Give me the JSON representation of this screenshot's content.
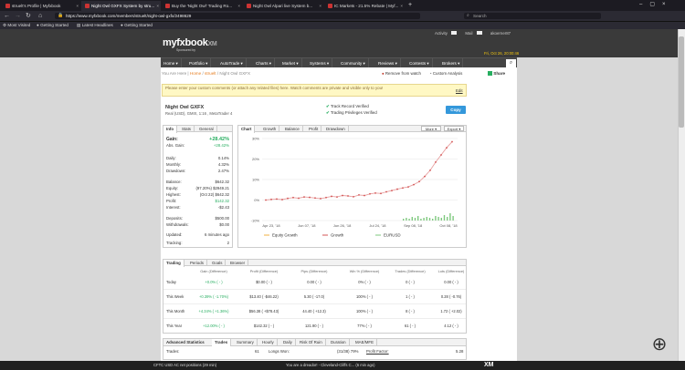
{
  "tabs": [
    {
      "label": "struelt's Profile | Myfxbook",
      "active": false
    },
    {
      "label": "Night Owl GXFX System by stru...",
      "active": true
    },
    {
      "label": "Buy the 'Night Owl' Trading Ro...",
      "active": false
    },
    {
      "label": "Night Owl Alpari live System b...",
      "active": false
    },
    {
      "label": "IC Markets - 21.5% Rebate | Myf...",
      "active": false
    }
  ],
  "browser": {
    "url": "https://www.myfxbook.com/members/struelt/night-owl-gxfx/2498629",
    "search_placeholder": "Search",
    "bookmarks": [
      "Most Visited",
      "Getting Started",
      "Latest Headlines",
      "Getting Started"
    ]
  },
  "site": {
    "logo": "myfxbook",
    "logo_sponsor": "Sponsored by",
    "logo_xm": "XM",
    "activity_label": "Activity",
    "mail_label": "Mail",
    "username": "akoerner87",
    "date": "Fri, Oct 26, 20:00:46",
    "nav": [
      "Home ▾",
      "Portfolio ▾",
      "AutoTrade ▾",
      "Charts ▾",
      "Market ▾",
      "Systems ▾",
      "Community ▾",
      "Reviews ▾",
      "Contests ▾",
      "Brokers ▾"
    ]
  },
  "breadcrumb": {
    "prefix": "You Are Here |",
    "home": "Home",
    "user": "struelt",
    "page": "Night Owl GXFX",
    "remove_watch": "Remove from watch",
    "custom_analysis": "Custom Analysis",
    "share": "Share"
  },
  "notice": {
    "text": "Please enter your custom comments (or attach any related files) here. Watch comments are private and visible only to you!",
    "edit": "Edit"
  },
  "system": {
    "name": "Night Owl GXFX",
    "details": "Real (USD), GMIX, 1:16 , MetaTrader 4",
    "track_verified": "Track Record Verified",
    "privileges_verified": "Trading Privileges Verified",
    "copy": "Copy"
  },
  "info": {
    "tabs": [
      "Info",
      "Stats",
      "General"
    ],
    "rows": [
      {
        "label": "Gain:",
        "value": "+28.42%",
        "cls": "green",
        "bold": true
      },
      {
        "label": "Abs. Gain:",
        "value": "+28.42%",
        "cls": "green"
      },
      {
        "label": "Daily:",
        "value": "0.14%",
        "cls": ""
      },
      {
        "label": "Monthly:",
        "value": "4.32%",
        "cls": ""
      },
      {
        "label": "Drawdown:",
        "value": "2.47%",
        "cls": ""
      },
      {
        "label": "Balance:",
        "value": "$642.32",
        "cls": ""
      },
      {
        "label": "Equity:",
        "value": "(97.20%) $2949.21",
        "cls": ""
      },
      {
        "label": "Highest:",
        "value": "(Oct 22) $642.32",
        "cls": ""
      },
      {
        "label": "Profit:",
        "value": "$142.32",
        "cls": "green"
      },
      {
        "label": "Interest:",
        "value": "-$2.43",
        "cls": ""
      },
      {
        "label": "Deposits:",
        "value": "$500.00",
        "cls": ""
      },
      {
        "label": "Withdrawals:",
        "value": "$0.00",
        "cls": ""
      },
      {
        "label": "Updated:",
        "value": "6 minutes ago",
        "cls": ""
      },
      {
        "label": "Tracking:",
        "value": "2",
        "cls": ""
      }
    ]
  },
  "chart_panel": {
    "tabs": [
      "Chart",
      "Growth",
      "Balance",
      "Profit",
      "Drawdown"
    ],
    "more": "More ▾",
    "export": "Export ▾",
    "legend": [
      "Equity Growth",
      "Growth",
      "EURUSD"
    ]
  },
  "chart_data": {
    "type": "line",
    "ylim": [
      -10,
      30
    ],
    "yticks": [
      "30%",
      "20%",
      "10%",
      "0%",
      "-10%"
    ],
    "xticks": [
      "Apr 23, '18",
      "Jun 07, '18",
      "Jun 26, '18",
      "Jul 24, '18",
      "Sep 08, '18",
      "Oct 08, '18"
    ],
    "series": [
      {
        "name": "Growth",
        "values": [
          0,
          0.3,
          0.5,
          0.2,
          0.8,
          1.2,
          0.9,
          1.5,
          1.3,
          1.0,
          0.7,
          1.2,
          1.8,
          1.5,
          2.2,
          2.0,
          1.6,
          2.5,
          2.2,
          3.0,
          3.4,
          3.2,
          4.0,
          4.6,
          5.3,
          5.9,
          6.4,
          7.5,
          9.0,
          11.5,
          14.5,
          18.5,
          22.0,
          25.5,
          28.42
        ]
      }
    ]
  },
  "trading": {
    "tabs": [
      "Trading",
      "Periods",
      "Goals",
      "Browser"
    ],
    "headers": [
      "Gain (Difference)",
      "Profit (Difference)",
      "Pips (Difference)",
      "Win % (Difference)",
      "Trades (Difference)",
      "Lots (Difference)"
    ],
    "rows": [
      {
        "label": "Today",
        "cells": [
          "+0.0% ( - )",
          "$0.00 ( - )",
          "0.00 ( - )",
          "0% ( - )",
          "0 ( - )",
          "0.00 ( - )"
        ]
      },
      {
        "label": "This Week",
        "cells": [
          "+0.39% ( -1.70%)",
          "$13.40 ( -$46.22)",
          "5.30 ( -17.0)",
          "100% ( - )",
          "1 ( - )",
          "0.28 ( -0.76)"
        ]
      },
      {
        "label": "This Month",
        "cells": [
          "+4.34% ( +1.36%)",
          "$56.38 ( +$78.43)",
          "44.40 ( +12.3)",
          "100% ( - )",
          "8 ( - )",
          "1.72 ( +2.02)"
        ]
      },
      {
        "label": "This Year",
        "cells": [
          "+12.00% ( - )",
          "$142.32 ( - )",
          "121.90 ( - )",
          "77% ( - )",
          "61 ( - )",
          "4.12 ( - )"
        ]
      }
    ]
  },
  "advanced": {
    "title": "Advanced Statistics",
    "tabs": [
      "Trades",
      "Summary",
      "Hourly",
      "Daily",
      "Risk Of Ruin",
      "Duration",
      "MAE/MFE"
    ],
    "trades_label": "Trades:",
    "trades_value": "61",
    "longs_label": "Longs Won:",
    "longs_value": "(31/38) 79%",
    "pf_label": "Profit Factor:",
    "pf_value": "5.28"
  },
  "taskbar": {
    "left": "CFTC USD AC net positions (29 min)",
    "mid": "You are a dreador! - Cleveland-Cliffs C... (6 min ago)",
    "xm": "XM"
  }
}
